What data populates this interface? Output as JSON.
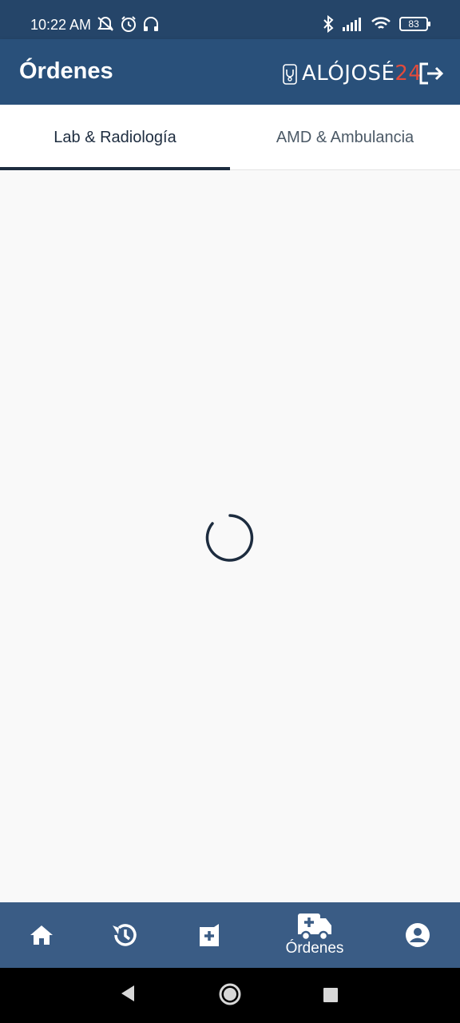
{
  "status_bar": {
    "time": "10:22 AM",
    "battery": "83",
    "icons": [
      "mute-icon",
      "alarm-icon",
      "headset-icon",
      "bluetooth-icon",
      "signal-icon",
      "wifi-icon",
      "battery-icon"
    ]
  },
  "app_bar": {
    "title": "Órdenes",
    "brand_text": "ALÓJOSÉ",
    "brand_number": "24",
    "logout_icon": "logout-icon"
  },
  "tabs": [
    {
      "label": "Lab & Radiología",
      "selected": true
    },
    {
      "label": "AMD & Ambulancia",
      "selected": false
    }
  ],
  "content": {
    "state": "loading",
    "spinner_icon": "loading-spinner-icon"
  },
  "bottom_nav": {
    "items": [
      {
        "icon": "home-icon",
        "label": ""
      },
      {
        "icon": "history-icon",
        "label": ""
      },
      {
        "icon": "pharmacy-icon",
        "label": ""
      },
      {
        "icon": "ambulance-icon",
        "label": "Órdenes",
        "selected": true
      },
      {
        "icon": "profile-icon",
        "label": ""
      }
    ]
  },
  "system_nav": [
    "back-icon",
    "home-circle-icon",
    "recents-icon"
  ],
  "colors": {
    "primary": "#29507a",
    "status_bar": "#254569",
    "bottom_nav": "#3a5c85",
    "tab_text_selected": "#1d2c3f",
    "brand_accent": "#e24b3b",
    "background": "#f9f9f9"
  }
}
